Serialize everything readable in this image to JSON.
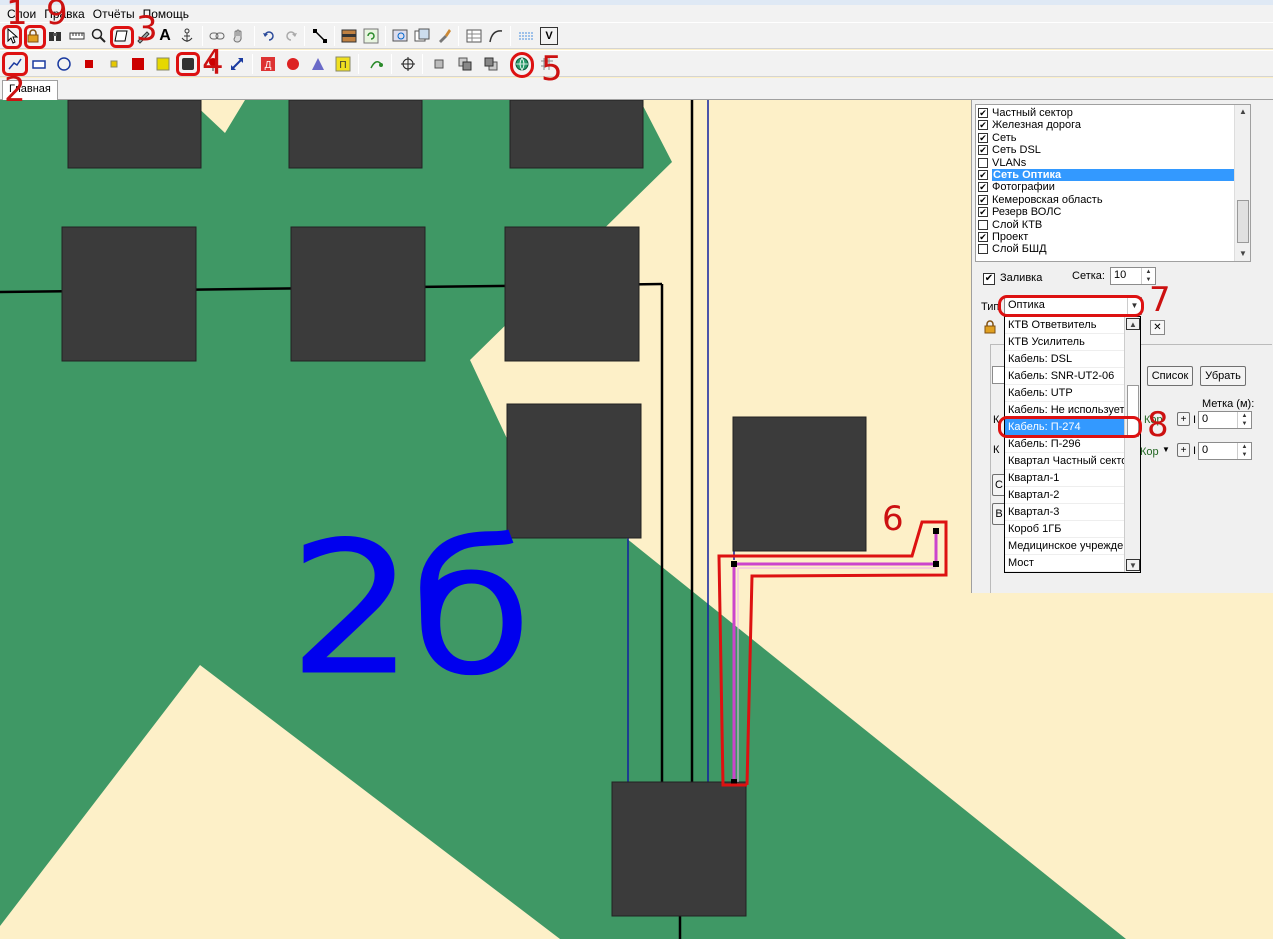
{
  "menu": [
    "Слои",
    "Правка",
    "Отчёты",
    "Помощь"
  ],
  "tab": "Главная",
  "map": {
    "label": "2б",
    "annotation_6": "6"
  },
  "layers": [
    {
      "label": "Частный сектор",
      "checked": true
    },
    {
      "label": "Железная дорога",
      "checked": true
    },
    {
      "label": "Сеть",
      "checked": true
    },
    {
      "label": "Сеть DSL",
      "checked": true
    },
    {
      "label": "VLANs",
      "checked": false
    },
    {
      "label": "Сеть Оптика",
      "checked": true,
      "selected": true
    },
    {
      "label": "Фотографии",
      "checked": true
    },
    {
      "label": "Кемеровская область",
      "checked": true
    },
    {
      "label": "Резерв ВОЛС",
      "checked": true
    },
    {
      "label": "Слой КТВ",
      "checked": false
    },
    {
      "label": "Проект",
      "checked": true
    },
    {
      "label": "Слой БШД",
      "checked": false
    }
  ],
  "fill": {
    "label": "Заливка",
    "checked": true
  },
  "grid": {
    "label": "Сетка:",
    "value": "10"
  },
  "type": {
    "label": "Тип",
    "value": "Оптика"
  },
  "type_options": [
    "КТВ Ответвитель",
    "КТВ Усилитель",
    "Кабель: DSL",
    "Кабель: SNR-UT2-06",
    "Кабель: UTP",
    "Кабель: Не используется",
    "Кабель: П-274",
    "Кабель: П-296",
    "Квартал Частный сектор",
    "Квартал-1",
    "Квартал-2",
    "Квартал-3",
    "Короб 1ГБ",
    "Медицинское учреждение",
    "Мост"
  ],
  "selected_option_index": 6,
  "buttons": {
    "list": "Список",
    "remove": "Убрать"
  },
  "mark": {
    "label": "Метка (м):",
    "value1": "0",
    "value2": "0"
  },
  "partial": {
    "kor1": "Кор",
    "kor2": "Кор",
    "k1": "К",
    "k2": "К",
    "c": "С",
    "b": "В",
    "plus": "+",
    "bar": "I"
  },
  "annotations": [
    "1",
    "2",
    "3",
    "4",
    "5",
    "6",
    "7",
    "8",
    "9"
  ],
  "colors": {
    "map_bg": "#fdf0c8",
    "green": "#3f9865",
    "block": "#3b3b3b",
    "label": "#0000ee",
    "ann": "#dd1111",
    "route": "#cc44cc"
  }
}
